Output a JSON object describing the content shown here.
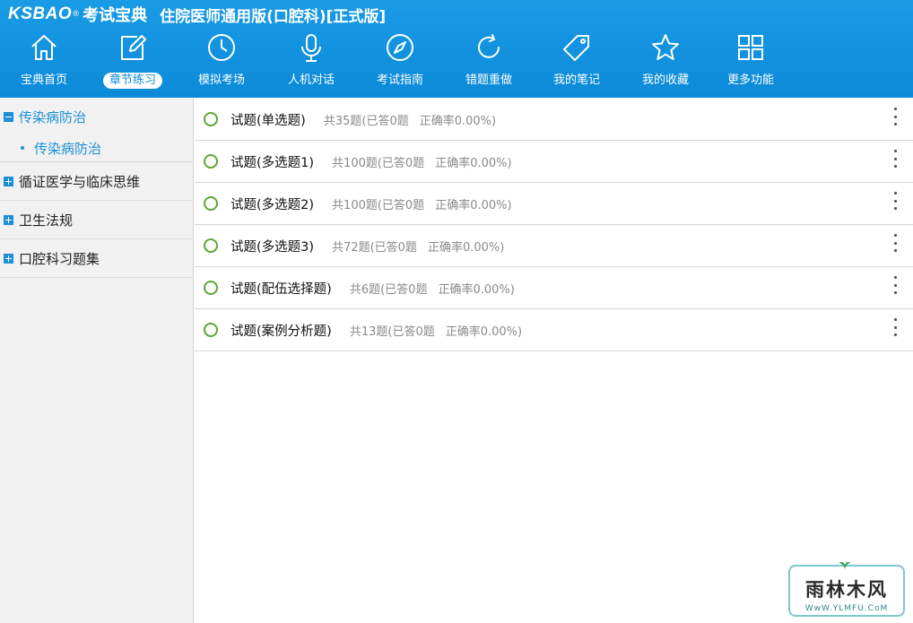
{
  "header": {
    "logo": "KSBAO",
    "logo_reg": "®",
    "logo_cn": "考试宝典",
    "app_title": "住院医师通用版(口腔科)[正式版]"
  },
  "nav": [
    {
      "label": "宝典首页",
      "icon": "home-icon"
    },
    {
      "label": "章节练习",
      "icon": "edit-icon",
      "active": true
    },
    {
      "label": "模拟考场",
      "icon": "clock-icon"
    },
    {
      "label": "人机对话",
      "icon": "microphone-icon"
    },
    {
      "label": "考试指南",
      "icon": "compass-icon"
    },
    {
      "label": "错题重做",
      "icon": "refresh-icon"
    },
    {
      "label": "我的笔记",
      "icon": "tag-icon"
    },
    {
      "label": "我的收藏",
      "icon": "star-icon"
    },
    {
      "label": "更多功能",
      "icon": "grid-icon"
    }
  ],
  "sidebar": {
    "nodes": [
      {
        "label": "传染病防治",
        "expanded": true,
        "children": [
          "传染病防治"
        ]
      },
      {
        "label": "循证医学与临床思维",
        "expanded": false
      },
      {
        "label": "卫生法规",
        "expanded": false
      },
      {
        "label": "口腔科习题集",
        "expanded": false
      }
    ]
  },
  "questions": [
    {
      "title": "试题(单选题)",
      "total": "共35题(已答0题",
      "accuracy": "正确率0.00%)"
    },
    {
      "title": "试题(多选题1)",
      "total": "共100题(已答0题",
      "accuracy": "正确率0.00%)"
    },
    {
      "title": "试题(多选题2)",
      "total": "共100题(已答0题",
      "accuracy": "正确率0.00%)"
    },
    {
      "title": "试题(多选题3)",
      "total": "共72题(已答0题",
      "accuracy": "正确率0.00%)"
    },
    {
      "title": "试题(配伍选择题)",
      "total": "共6题(已答0题",
      "accuracy": "正确率0.00%)"
    },
    {
      "title": "试题(案例分析题)",
      "total": "共13题(已答0题",
      "accuracy": "正确率0.00%)"
    }
  ],
  "watermark": {
    "logo": "雨林木风",
    "url": "WwW.YLMFU.CoM"
  },
  "colors": {
    "header": "#0b8ad8",
    "accent": "#1c8fd8",
    "circle": "#5aa832"
  }
}
